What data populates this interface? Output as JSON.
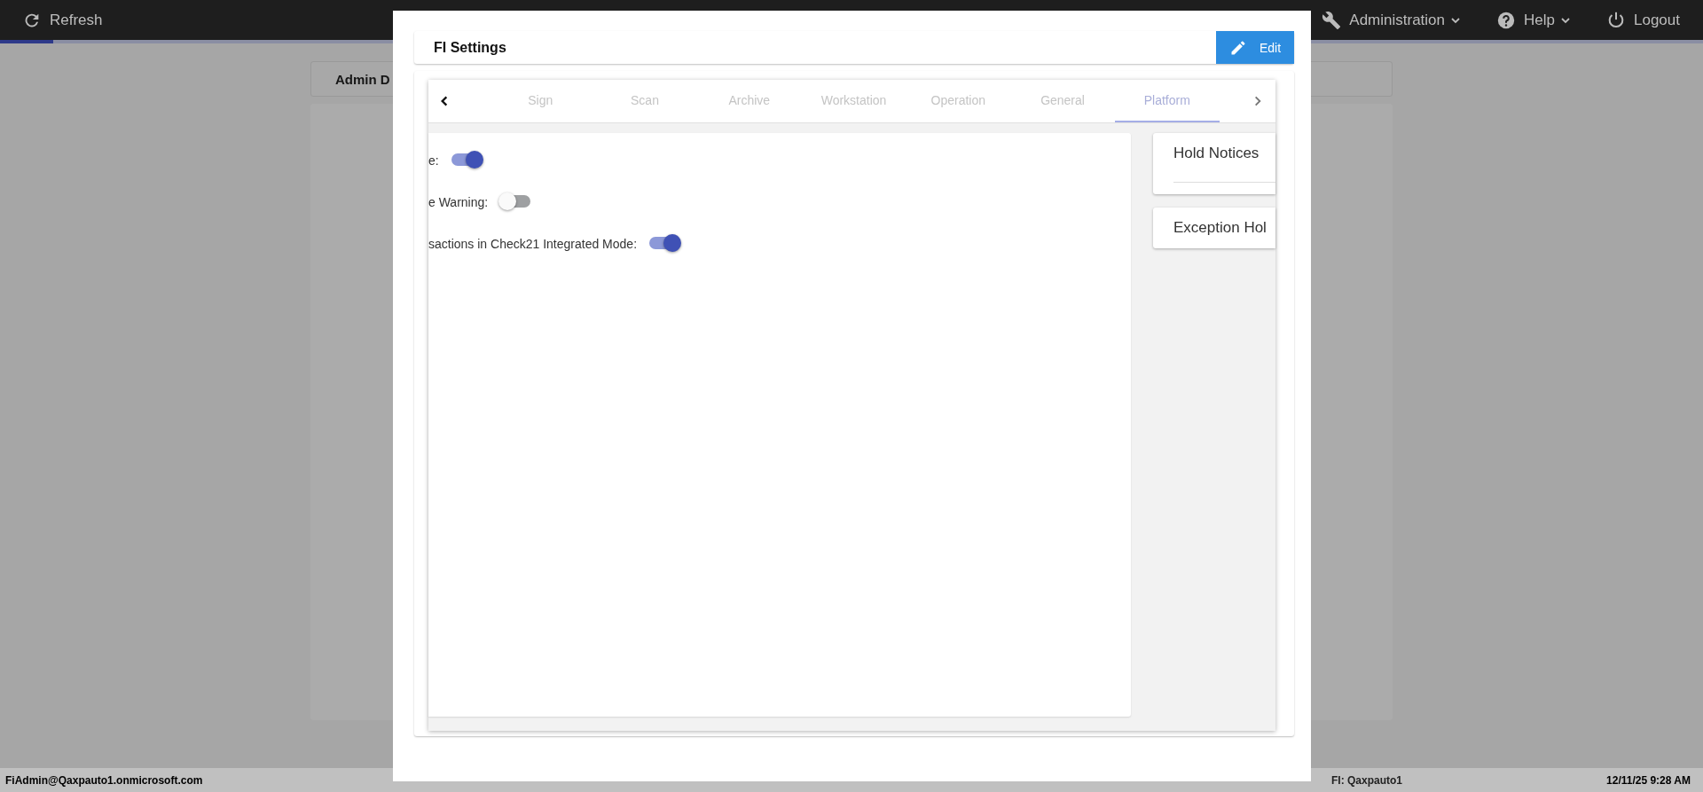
{
  "topbar": {
    "refresh": "Refresh",
    "menus": [
      {
        "kind": "admin",
        "label": "Administration",
        "dropdown": true
      },
      {
        "kind": "help",
        "label": "Help",
        "dropdown": true
      },
      {
        "kind": "logout",
        "label": "Logout",
        "dropdown": false
      }
    ]
  },
  "page": {
    "card_title": "Admin D"
  },
  "modal": {
    "title": "FI Settings",
    "edit_button": "Edit",
    "tabs": [
      {
        "label": "Sign",
        "selected": false
      },
      {
        "label": "Scan",
        "selected": false
      },
      {
        "label": "Archive",
        "selected": false
      },
      {
        "label": "Workstation",
        "selected": false
      },
      {
        "label": "Operation",
        "selected": false
      },
      {
        "label": "General",
        "selected": false
      },
      {
        "label": "Platform",
        "selected": true
      }
    ],
    "settings": [
      {
        "label": "e:",
        "on": true
      },
      {
        "label": "e Warning:",
        "on": false
      },
      {
        "label": "sactions in Check21 Integrated Mode:",
        "on": true
      }
    ],
    "side_cards": [
      {
        "title": "Hold Notices",
        "divider": true
      },
      {
        "title": "Exception Hol",
        "divider": false
      }
    ]
  },
  "status_bar": {
    "user": "FiAdmin@Qaxpauto1.onmicrosoft.com",
    "fi": "FI: Qaxpauto1",
    "datetime": "12/11/25 9:28 AM"
  }
}
